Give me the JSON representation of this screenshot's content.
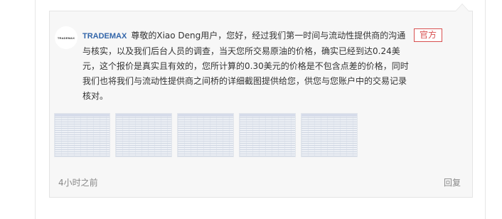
{
  "comment": {
    "author": "TRADEMAX",
    "avatar_text": "TRADEMAX",
    "badge": "官方",
    "text": "尊敬的Xiao Deng用户，您好，经过我们第一时间与流动性提供商的沟通与核实，以及我们后台人员的调查，当天您所交易原油的价格，确实已经到达0.24美元，这个报价是真实且有效的，您所计算的0.30美元的价格是不包含点差的价格，同时我们也将我们与流动性提供商之间桥的详细截图提供给您，供您与您账户中的交易记录核对。",
    "time": "4小时之前",
    "reply_label": "回复"
  },
  "attachments": [
    {
      "icon": "screenshot-thumbnail"
    },
    {
      "icon": "screenshot-thumbnail"
    },
    {
      "icon": "screenshot-thumbnail"
    },
    {
      "icon": "screenshot-thumbnail"
    },
    {
      "icon": "screenshot-thumbnail"
    }
  ],
  "colors": {
    "author": "#3366aa",
    "badge": "#d85050",
    "card_bg": "#f7f7f7",
    "muted_text": "#888888"
  }
}
